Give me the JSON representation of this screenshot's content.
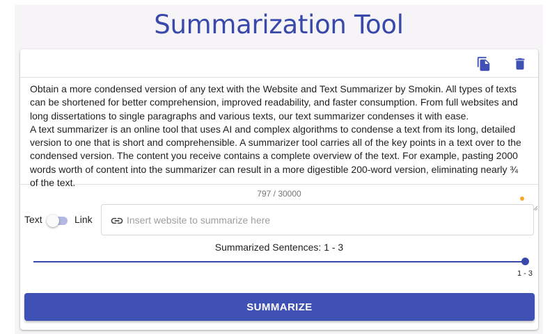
{
  "header": {
    "title": "Summarization Tool"
  },
  "toolbar": {
    "copy_icon": "copy-icon",
    "delete_icon": "delete-icon"
  },
  "editor": {
    "paragraphs": [
      "Obtain a more condensed version of any text with the Website and Text Summarizer by Smokin. All types of texts can be shortened for better comprehension, improved readability, and faster consumption. From full websites and long dissertations to single paragraphs and various texts, our text summarizer condenses it with ease.",
      "A text summarizer is an online tool that uses AI and complex algorithms to condense a text from its long, detailed version to one that is short and comprehensible. A summarizer tool carries all of the key points in a text over to the condensed version. The content you receive contains a complete overview of the text. For example, pasting 2000 words worth of content into the summarizer can result in a more digestible 200-word version, eliminating nearly ¾ of the text."
    ],
    "counter": "797 / 30000"
  },
  "mode_toggle": {
    "left_label": "Text",
    "right_label": "Link",
    "checked": false
  },
  "url_input": {
    "placeholder": "Insert website to summarize here",
    "value": "",
    "icon": "link-icon"
  },
  "slider": {
    "label": "Summarized Sentences: 1 - 3",
    "value_label": "1 - 3",
    "value": 3,
    "min": 1,
    "max": 3
  },
  "summarize_button": {
    "label": "SUMMARIZE"
  },
  "colors": {
    "primary": "#3f51b5",
    "title": "#3949ab",
    "indicator": "#f5a623"
  }
}
